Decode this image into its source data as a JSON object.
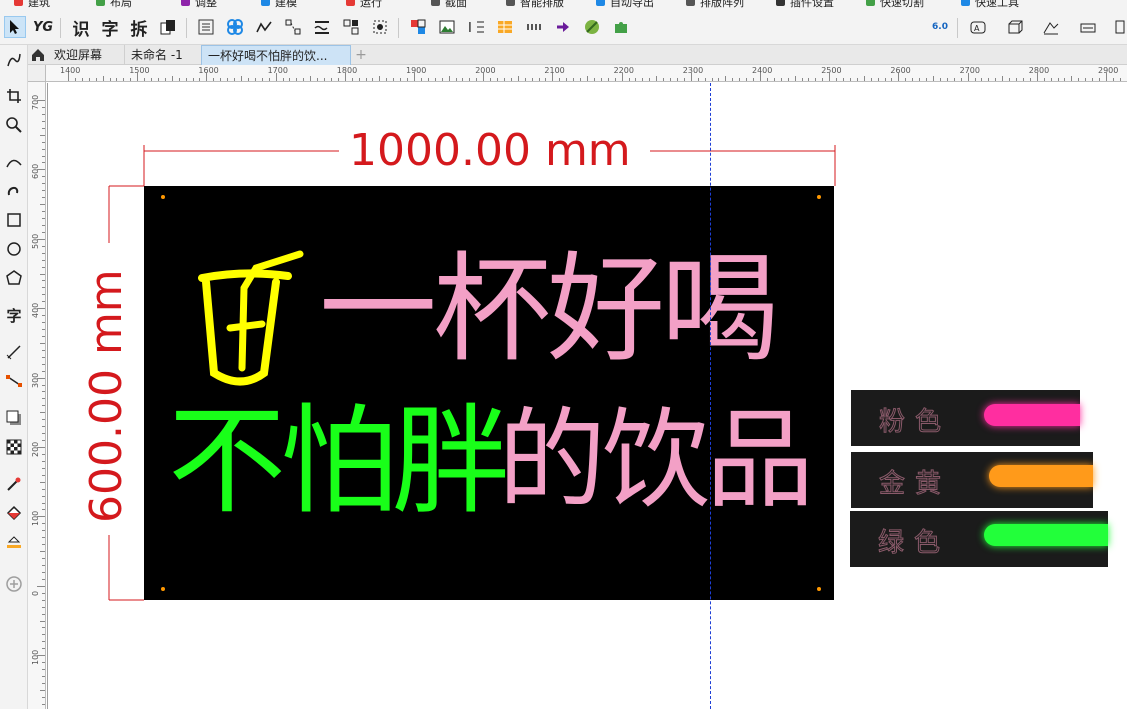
{
  "top_menu_fragments": [
    "建筑",
    "布局",
    "调整",
    "建模",
    "运行",
    "截面",
    "智能排版",
    "自动导出",
    "排版阵列",
    "插件设置",
    "快速切割",
    "快速工具"
  ],
  "toolbar": {
    "chars": [
      "识",
      "字",
      "拆"
    ],
    "badge": "6.0"
  },
  "tabs": [
    {
      "label": "欢迎屏幕",
      "active": false
    },
    {
      "label": "未命名 -1",
      "active": false
    },
    {
      "label": "一杯好喝不怕胖的饮...",
      "active": true
    }
  ],
  "ruler": {
    "top": [
      "1400",
      "1500",
      "1600",
      "1700",
      "1800",
      "1900",
      "2000",
      "2100",
      "2200",
      "2300",
      "2400",
      "2500",
      "2600",
      "2700",
      "2800",
      "2900"
    ],
    "left": [
      "700",
      "600",
      "500",
      "400",
      "300",
      "200",
      "100",
      "0",
      "100"
    ]
  },
  "dimensions": {
    "width": "1000.00 mm",
    "height": "600.00 mm",
    "color": "#d4191d"
  },
  "sign": {
    "line1": "一杯好喝",
    "line2_green": "不怕胖",
    "line2_pink": "的饮品",
    "colors": {
      "yellow": "#ffff00",
      "pink": "#f3a0c6",
      "green": "#19ff19",
      "background": "#000000"
    }
  },
  "swatches": [
    {
      "label": "粉色",
      "color": "#ff2ea0"
    },
    {
      "label": "金黄",
      "color": "#ff9a1a"
    },
    {
      "label": "绿色",
      "color": "#22ff3a"
    }
  ]
}
